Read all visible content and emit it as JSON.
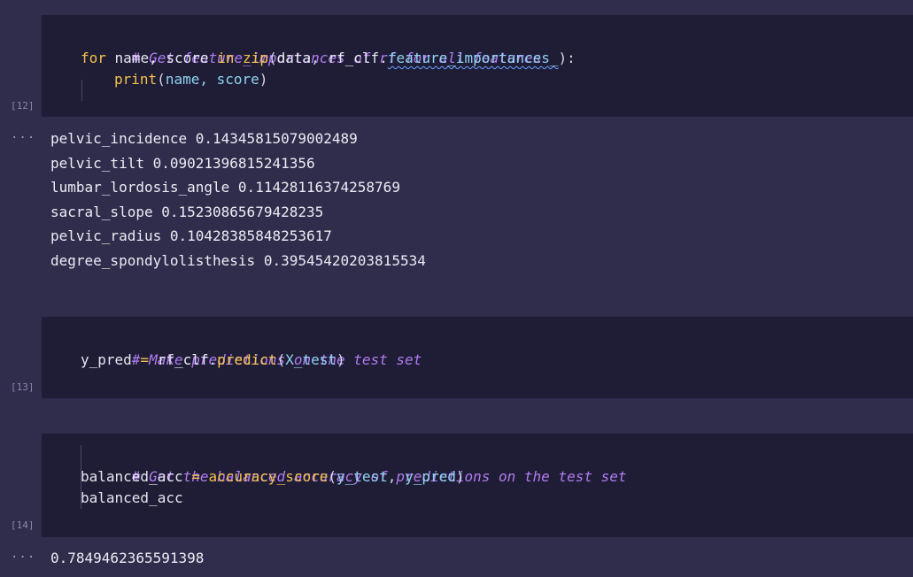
{
  "cells": [
    {
      "exec_count": "[12]",
      "code": {
        "l1": "# Get feature_importances of rf for all features",
        "l2_for": "for",
        "l2_name": " name, score ",
        "l2_in": "in",
        "l2_sp": " ",
        "l2_zip": "zip",
        "l2_paren": "(",
        "l2_data": "data",
        "l2_comma": ", ",
        "l2_rfclf": "rf_clf",
        "l2_dot": ".",
        "l2_attr": "feature_importances_",
        "l2_close": "):",
        "l3_print": "print",
        "l3_paren": "(",
        "l3_args": "name, score",
        "l3_close": ")"
      },
      "output": {
        "ellipsis": "···",
        "lines": [
          "pelvic_incidence 0.14345815079002489",
          "pelvic_tilt 0.09021396815241356",
          "lumbar_lordosis_angle 0.11428116374258769",
          "sacral_slope 0.15230865679428235",
          "pelvic_radius 0.10428385848253617",
          "degree_spondylolisthesis 0.39545420203815534"
        ]
      }
    },
    {
      "exec_count": "[13]",
      "code": {
        "l1": "# Make predictions on the test set",
        "l2_var": "y_pred",
        "l2_eq": " = ",
        "l2_obj": "rf_clf",
        "l2_dot": ".",
        "l2_fn": "predict",
        "l2_paren": "(",
        "l2_arg": "X_test",
        "l2_close": ")"
      }
    },
    {
      "exec_count": "[14]",
      "code": {
        "l1": "# Get the balanced accuracy of predictions on the test set",
        "l2_var": "balanced_acc",
        "l2_eq": " = ",
        "l2_fn": "accuracy_score",
        "l2_paren": "(",
        "l2_a1": "y_test",
        "l2_comma": ", ",
        "l2_a2": "y_pred",
        "l2_close": ")",
        "l3": "balanced_acc"
      },
      "output": {
        "ellipsis": "···",
        "lines": [
          "0.7849462365591398"
        ]
      }
    }
  ]
}
